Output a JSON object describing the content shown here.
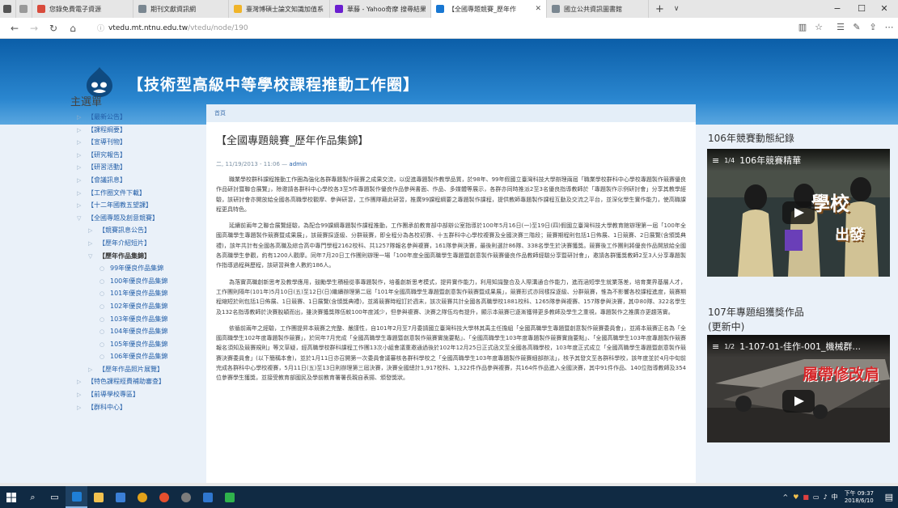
{
  "browser": {
    "tabs": [
      {
        "label": "您錄免費電子資源",
        "color": "#d84b3c"
      },
      {
        "label": "期刊文獻資訊網",
        "color": "#7a8791"
      },
      {
        "label": "臺灣博碩士論文知識加值系",
        "color": "#f0b429"
      },
      {
        "label": "華藤 - Yahoo奇摩 搜尋結果",
        "color": "#6b1fd0"
      },
      {
        "label": "【全國專題競賽_歷年作",
        "color": "#1877d2",
        "active": true
      },
      {
        "label": "國立公共資訊圖書館",
        "color": "#7a8791"
      }
    ],
    "url_host": "vtedu.mt.ntnu.edu.tw",
    "url_path": "/vtedu/node/190"
  },
  "site": {
    "title": "【技術型高級中等學校課程推動工作圈】",
    "breadcrumb": "首頁"
  },
  "sidebar": {
    "title": "主選單",
    "items": [
      {
        "label": "【最新公告】",
        "level": 0
      },
      {
        "label": "【課程綱要】",
        "level": 0
      },
      {
        "label": "【宣導刊物】",
        "level": 0
      },
      {
        "label": "【研究報告】",
        "level": 0
      },
      {
        "label": "【研習活動】",
        "level": 0
      },
      {
        "label": "【會議訊息】",
        "level": 0
      },
      {
        "label": "【工作圈文件下載】",
        "level": 0
      },
      {
        "label": "【十二年國教五望課】",
        "level": 0
      },
      {
        "label": "【全國專題及創意競賽】",
        "level": 0,
        "expanded": true
      },
      {
        "label": "【競賽訊息公告】",
        "level": 1
      },
      {
        "label": "【歷年介紹短片】",
        "level": 1
      },
      {
        "label": "【歷年作品集錦】",
        "level": 1,
        "expanded": true,
        "active": true
      },
      {
        "label": "99年優良作品集錦",
        "level": 2
      },
      {
        "label": "100年優良作品集錦",
        "level": 2
      },
      {
        "label": "101年優良作品集錦",
        "level": 2
      },
      {
        "label": "102年優良作品集錦",
        "level": 2
      },
      {
        "label": "103年優良作品集錦",
        "level": 2
      },
      {
        "label": "104年優良作品集錦",
        "level": 2
      },
      {
        "label": "105年優良作品集錦",
        "level": 2
      },
      {
        "label": "106年優良作品集錦",
        "level": 2
      },
      {
        "label": "【歷年作品照片展覽】",
        "level": 1
      },
      {
        "label": "【特色課程經費補助審查】",
        "level": 0
      },
      {
        "label": "【前導學校專區】",
        "level": 0
      },
      {
        "label": "【群科中心】",
        "level": 0
      }
    ]
  },
  "article": {
    "title": "【全國專題競賽_歷年作品集錦】",
    "date": "二, 11/19/2013 - 11:06 —",
    "author": "admin",
    "paragraphs": [
      "職業學校群科課程推動工作圈為強化各群專題製作競賽之成果交流，以促進專題製作教學品質，於98年、99年假國立臺灣科技大學辦理兩屆「職業學校群科中心學校專題製作競賽優良作品研討暨聯合展覽」，除邀請各群科中心學校各3至5件專題製作優良作品參與書面、作品、多媒體等展示，各群亦同時推派2至3名優良指導教師於「專題製作示例研討會」分享其教學經驗，該研討會亦開放給全國各高職學校觀摩、參與研習，工作團隊藉此研習，推廣99課程綱要之專題製作課程，提供教師專題製作課程互動及交流之平台，並深化學生實作能力，使高職課程更具特色。",
      "延續前兩年之聯合展覽經驗，為配合99課綱專題製作課程推動，工作團承前教育部中部辦公室指導於100年5月16日(一)至19日(四)假國立臺灣科技大學教育館辦理第一屆「100年全國高職學生專題製作競賽暨成果展」，該競賽採逐級、分群競賽，即全程分為各校初賽、十五群科中心學校複賽及全國決賽三階段；競賽期程則包括1日佈展、1日競賽、2日展覽(含頒獎典禮)，該年共計有全國各高職及綜合高中專門學程2162校科、共1257隊報名參與複賽，161隊參與決賽，最後則選計86隊、338名學生於決賽獲獎。競賽後工作團則將優良作品開放給全國各高職學生參觀，約有1200人觀摩。同年7月20日工作團則辦理一場「100年度全國高職學生專題暨創意製作競賽優良作品教師經驗分享暨研討會」，邀請各群獲獎教師2至3人分享專題製作指導過程與歷程，該研習與會人數約186人。",
      "為落實高職創新思考及教學應用，鼓勵學生積極從事專題製作，培養創新思考模式，提昇實作能力，利用知識整合及人際溝通合作能力，進而涵短學生就業落差，培育業界基層人才，工作團則隔年(101年)5月10日(五)至12日(日)繼續辦理第二屆「101年全國高職學生專題暨創意製作競賽暨成果展」，競賽形式亦同樣採逐級、分群競賽，惟為不影響各校課程進度，競賽期程縮短於則包括1日佈展、1日競賽、1日展覽(含頒獎典禮)，並將競賽時程訂於週末，該次競賽共計全國各高職學校1881校科、1265隊參與複賽、157隊參與決賽，其中80隊、322名學生及132名指導教師於決賽脫穎而出，雖決賽獲獎隊伍較100年度減少，但參與複賽、決賽之隊伍均有提升，顯示本競賽已逐漸獲得更多教師及學生之重視，專題製作之推廣亦更趨落實。",
      "依循前兩年之經驗，工作團提昇本競賽之完整、嚴謹性，自101年2月至7月委請國立臺灣科技大學林其禹主任擔組「全國高職學生專題暨創意製作競賽委員會」，並將本競賽正名為「全國高職學生102年度專題製作競賽」，於同年7月完成「全國高職學生專題暨創意製作競賽實施要點」、「全國高職學生103年度專題製作競賽實施要點」、「全國高職學生103年度專題製作競賽報名須知及競賽規則」等文草疑，經高職學校群科課程工作團13次小組會議重邀通過後於102年12月25日正式函文至全國各高職學校，103年度正式成立「全國高職學生專題暨創意製作競賽決賽委員會」(以下簡稱本會)，並於1月11日亦召開第一次委員會議審核各群科學校之「全國高職學生103年度專題製作競賽細部辦法」，核予其發文至各群科學校，該年度並於4月中旬前完成各群科中心學校複賽，5月11日(五)至13日則辦理第三屆決賽，決賽全國總計1,917校科、1,322件作品參與複賽，共164件作品進入全國決賽，其中91件作品、140位指導教師及354位參賽學生獲獎，並接受教育部國民及學前教育署署長親自表揚、頒發獎狀。"
    ]
  },
  "right": {
    "heading1": "106年競賽動態紀錄",
    "video1": {
      "counter": "1/4",
      "title": "106年競賽精華",
      "overlay1": "學校",
      "overlay2": "出發"
    },
    "heading2": "107年專題組獲獎作品",
    "heading2b": "(更新中)",
    "video2": {
      "counter": "1/2",
      "title": "1-107-01-佳作-001_機械群...",
      "overlay1": "履帶修改肩"
    }
  },
  "taskbar": {
    "tray_lang": "中",
    "time": "下午 09:37",
    "date": "2018/6/10"
  },
  "colors": {
    "header_blue": "#1f6fb8",
    "link_blue": "#225ea8",
    "taskbar": "#102a43"
  }
}
